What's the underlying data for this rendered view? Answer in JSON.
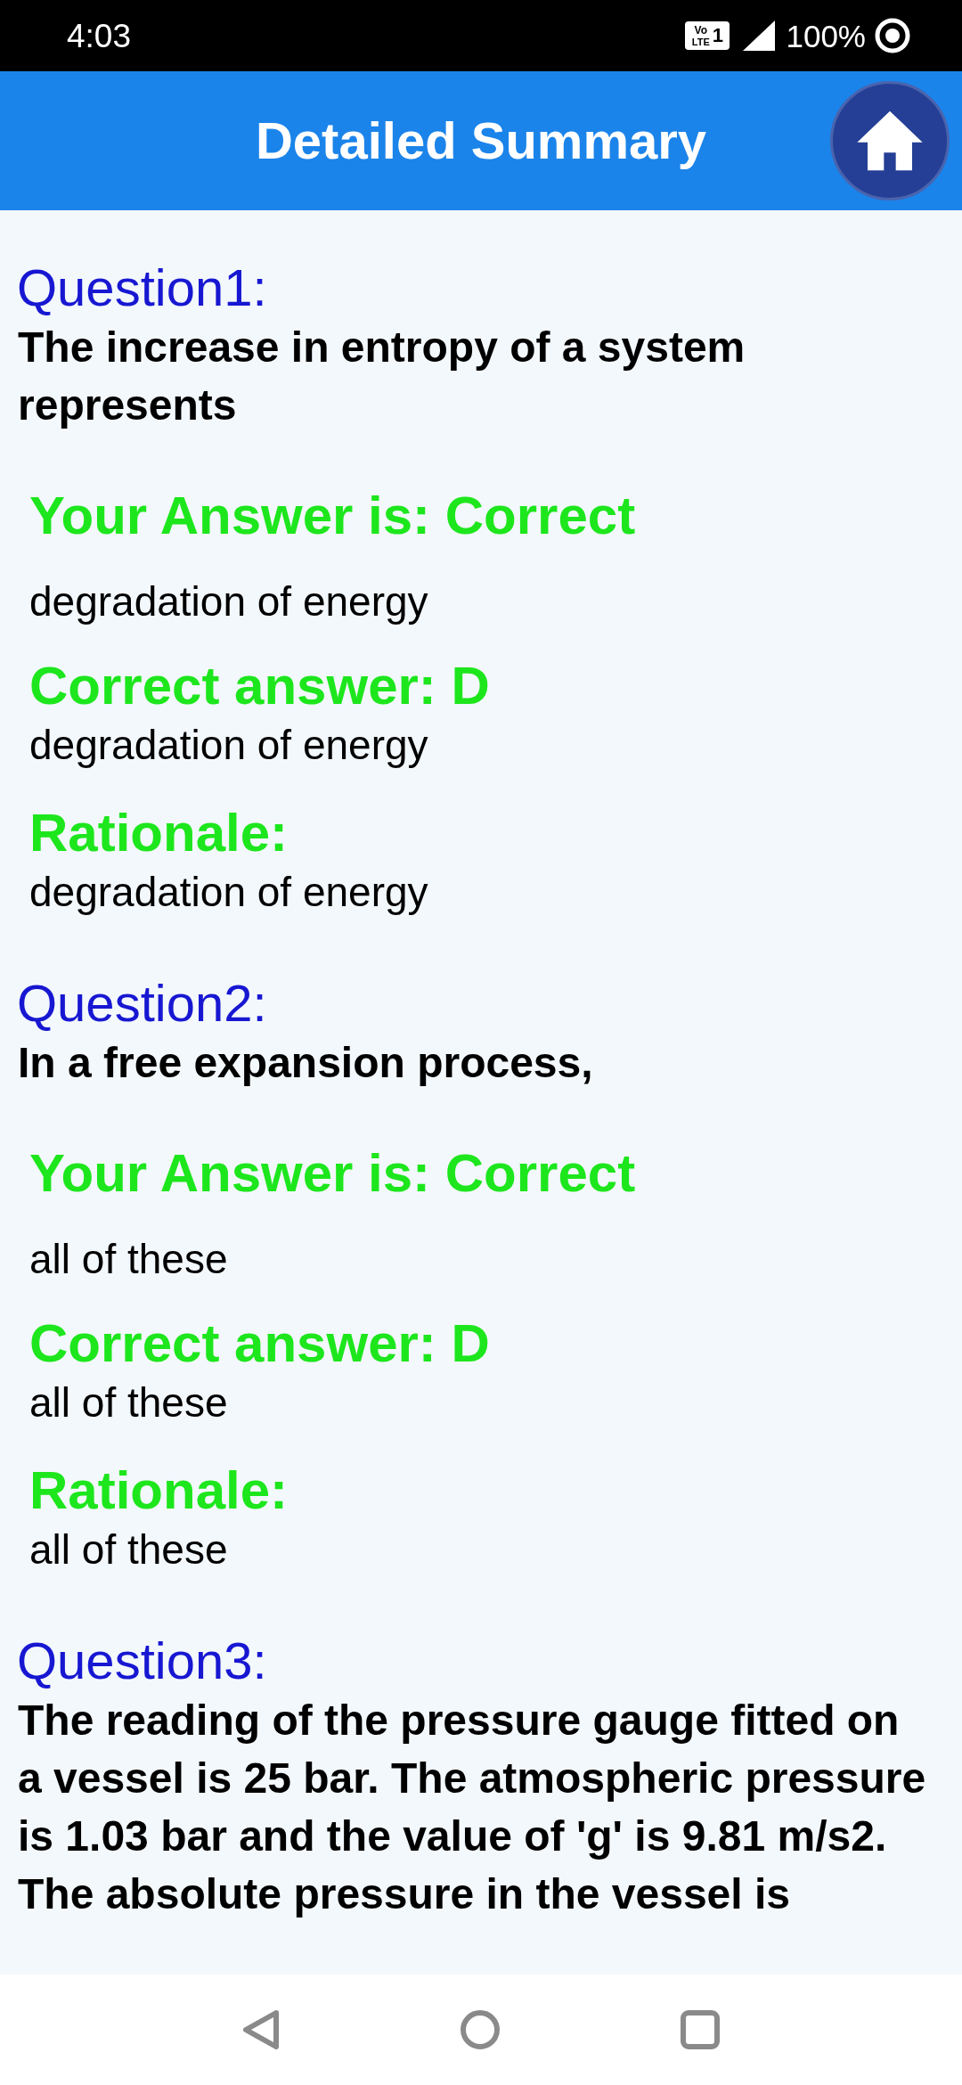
{
  "status_bar": {
    "time": "4:03",
    "network_badge": {
      "line_1": "Vo",
      "line_2": "LTE",
      "sim": "1"
    },
    "battery": "100%"
  },
  "header": {
    "title": "Detailed Summary"
  },
  "questions": [
    {
      "label": "Question1:",
      "text": "The increase in entropy of a system represents",
      "correct": true,
      "verdict": "Your Answer is: Correct",
      "your_answer": "degradation of energy",
      "correct_answer_heading": "Correct answer: D",
      "correct_answer": "degradation of energy",
      "rationale_heading": "Rationale:",
      "rationale": "degradation of energy"
    },
    {
      "label": "Question2:",
      "text": "In a free expansion process,",
      "correct": true,
      "verdict": "Your Answer is: Correct",
      "your_answer": "all of these",
      "correct_answer_heading": "Correct answer: D",
      "correct_answer": "all of these",
      "rationale_heading": "Rationale:",
      "rationale": "all of these"
    },
    {
      "label": "Question3:",
      "text": "The reading of the pressure gauge fitted on a vessel is 25 bar. The atmospheric pressure is 1.03 bar and the value of 'g' is 9.81 m/s2. The absolute pressure in the vessel is"
    }
  ]
}
